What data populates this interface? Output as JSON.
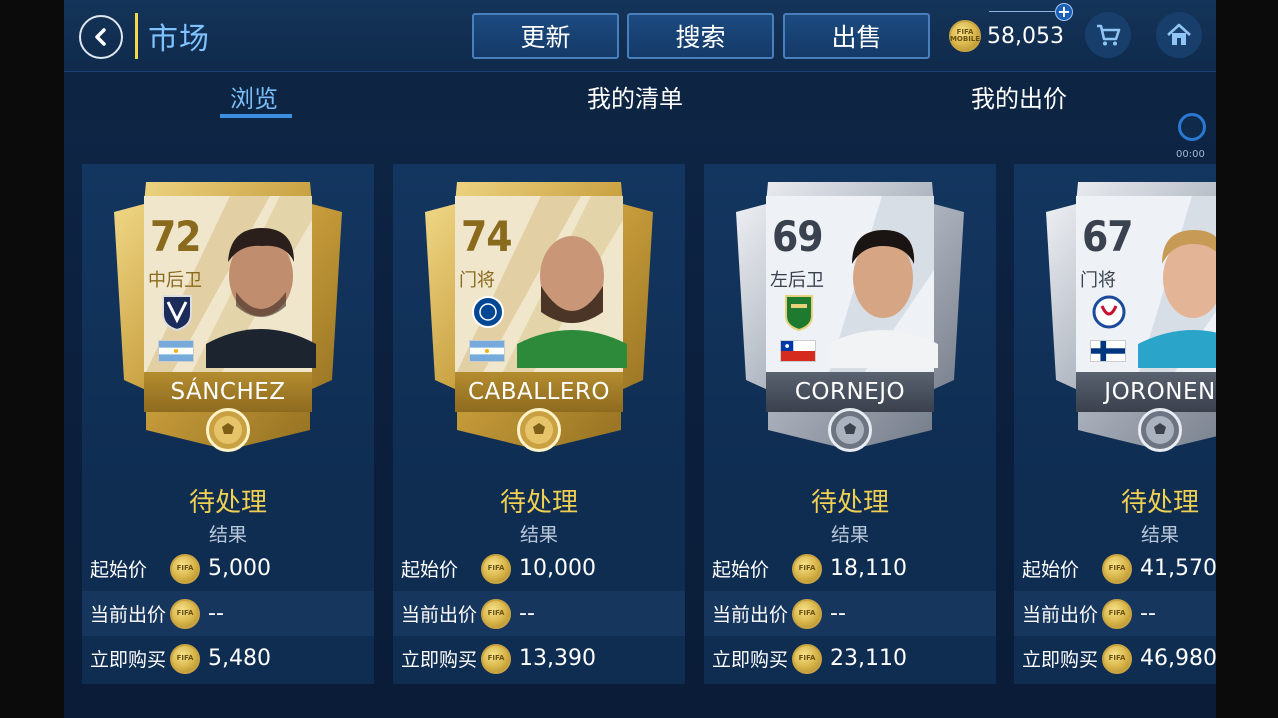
{
  "header": {
    "title": "市场",
    "buttons": {
      "refresh": "更新",
      "search": "搜索",
      "sell": "出售"
    },
    "coins": "58,053",
    "coin_label": "FIFA MOBILE",
    "plus": "+"
  },
  "tabs": [
    {
      "label": "浏览",
      "active": true
    },
    {
      "label": "我的清单",
      "active": false
    },
    {
      "label": "我的出价",
      "active": false
    }
  ],
  "timer": "00:00",
  "listings": [
    {
      "rating": "72",
      "position": "中后卫",
      "name": "SÁNCHEZ",
      "tier": "gold",
      "club": "monterrey-badge",
      "flag": "argentina",
      "status": "待处理",
      "result": "结果",
      "start_label": "起始价",
      "start_price": "5,000",
      "current_label": "当前出价",
      "current_bid": "--",
      "buy_label": "立即购买",
      "buy_now": "5,480"
    },
    {
      "rating": "74",
      "position": "门将",
      "name": "CABALLERO",
      "tier": "gold",
      "club": "chelsea-badge",
      "flag": "argentina",
      "status": "待处理",
      "result": "结果",
      "start_label": "起始价",
      "start_price": "10,000",
      "current_label": "当前出价",
      "current_bid": "--",
      "buy_label": "立即购买",
      "buy_now": "13,390"
    },
    {
      "rating": "69",
      "position": "左后卫",
      "name": "CORNEJO",
      "tier": "silver",
      "club": "leon-badge",
      "flag": "chile",
      "status": "待处理",
      "result": "结果",
      "start_label": "起始价",
      "start_price": "18,110",
      "current_label": "当前出价",
      "current_bid": "--",
      "buy_label": "立即购买",
      "buy_now": "23,110"
    },
    {
      "rating": "67",
      "position": "门将",
      "name": "JORONEN",
      "tier": "silver",
      "club": "copenhagen-badge",
      "flag": "finland",
      "status": "待处理",
      "result": "结果",
      "start_label": "起始价",
      "start_price": "41,570",
      "current_label": "当前出价",
      "current_bid": "--",
      "buy_label": "立即购买",
      "buy_now": "46,980"
    }
  ],
  "colors": {
    "accent_blue": "#7fc2ff",
    "status_gold": "#f0d052",
    "background": "#0c2140"
  }
}
